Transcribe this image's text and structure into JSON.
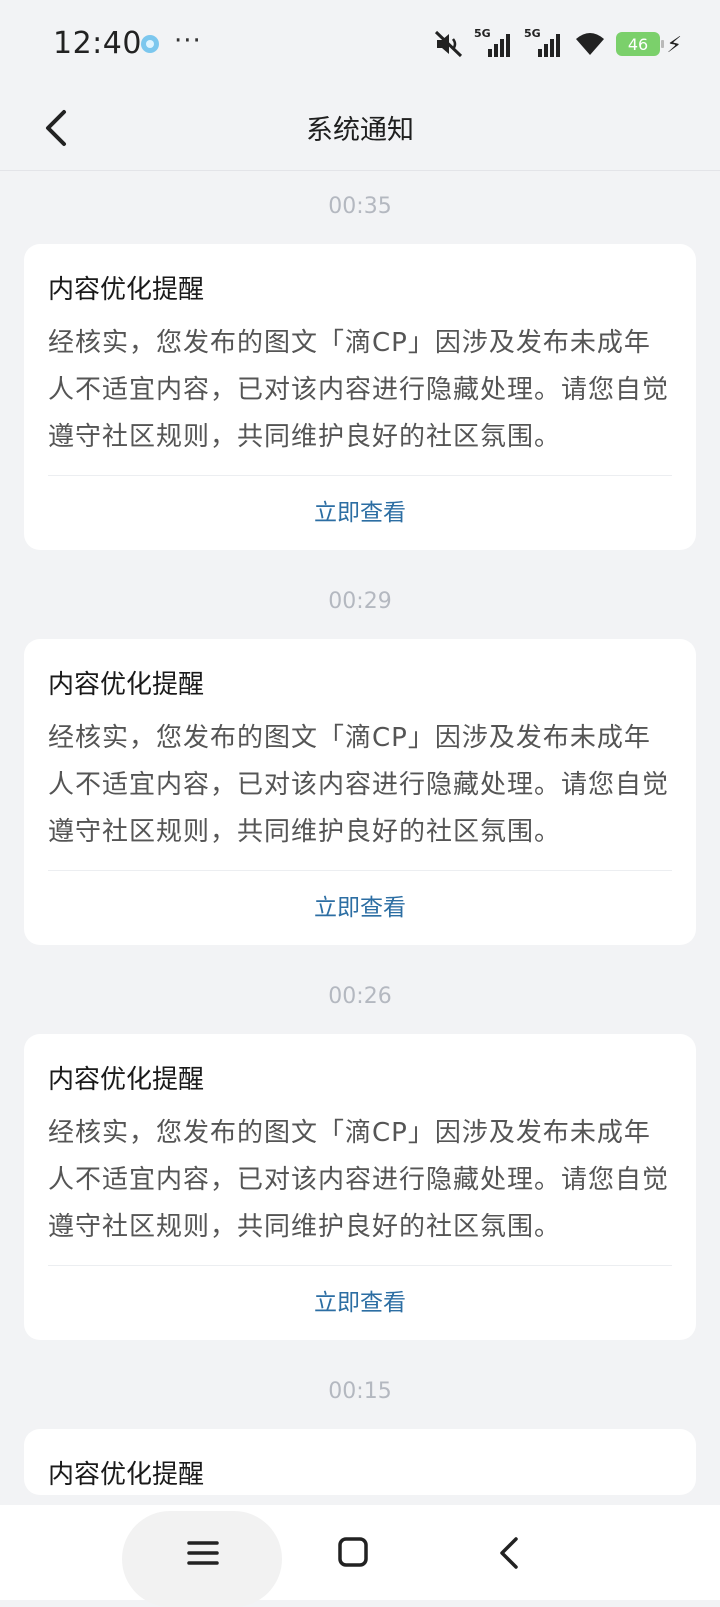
{
  "status": {
    "time": "12:40",
    "more": "···",
    "network_1": "5G",
    "network_2": "5G",
    "battery": "46"
  },
  "header": {
    "title": "系统通知"
  },
  "notifications": [
    {
      "time": "00:35",
      "title": "内容优化提醒",
      "body": "经核实，您发布的图文「滴CP」因涉及发布未成年人不适宜内容，已对该内容进行隐藏处理。请您自觉遵守社区规则，共同维护良好的社区氛围。",
      "action": "立即查看"
    },
    {
      "time": "00:29",
      "title": "内容优化提醒",
      "body": "经核实，您发布的图文「滴CP」因涉及发布未成年人不适宜内容，已对该内容进行隐藏处理。请您自觉遵守社区规则，共同维护良好的社区氛围。",
      "action": "立即查看"
    },
    {
      "time": "00:26",
      "title": "内容优化提醒",
      "body": "经核实，您发布的图文「滴CP」因涉及发布未成年人不适宜内容，已对该内容进行隐藏处理。请您自觉遵守社区规则，共同维护良好的社区氛围。",
      "action": "立即查看"
    },
    {
      "time": "00:15",
      "title": "内容优化提醒"
    }
  ],
  "icons": {
    "back": "chevron-left-icon",
    "menu": "hamburger-menu-icon",
    "home": "square-home-icon",
    "sys_back": "chevron-left-icon"
  }
}
